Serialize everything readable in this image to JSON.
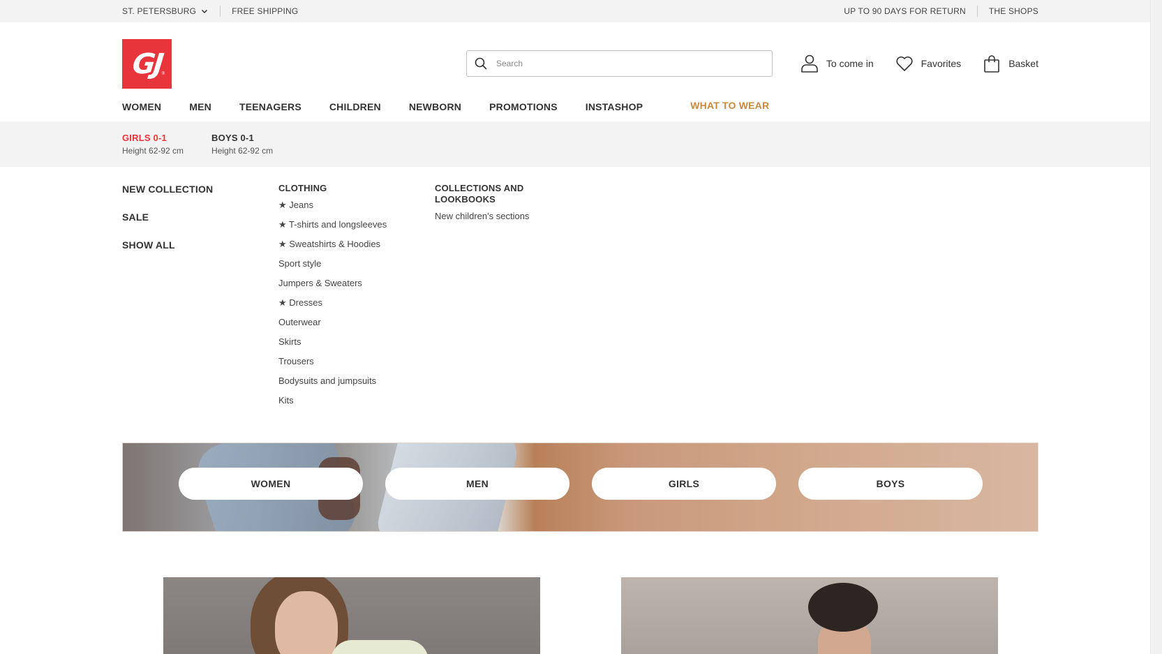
{
  "topbar": {
    "city": "ST. PETERSBURG",
    "shipping": "FREE SHIPPING",
    "returns": "UP TO 90 DAYS FOR RETURN",
    "shops": "THE SHOPS"
  },
  "header": {
    "logo": "GJ",
    "search_placeholder": "Search",
    "login": "To come in",
    "favorites": "Favorites",
    "basket": "Basket"
  },
  "nav": {
    "items": [
      "WOMEN",
      "MEN",
      "TEENAGERS",
      "CHILDREN",
      "NEWBORN",
      "PROMOTIONS",
      "INSTASHOP"
    ],
    "accent": "WHAT TO WEAR",
    "accent_color": "#c8893d"
  },
  "subnav": [
    {
      "title": "GIRLS 0-1",
      "subtitle": "Height 62-92 cm",
      "active": true
    },
    {
      "title": "BOYS 0-1",
      "subtitle": "Height 62-92 cm",
      "active": false
    }
  ],
  "menu": {
    "col1": [
      "NEW COLLECTION",
      "SALE",
      "SHOW ALL"
    ],
    "clothing_title": "CLOTHING",
    "clothing": [
      "★ Jeans",
      "★ T-shirts and longsleeves",
      "★ Sweatshirts & Hoodies",
      "Sport style",
      "Jumpers & Sweaters",
      "★ Dresses",
      "Outerwear",
      "Skirts",
      "Trousers",
      "Bodysuits and jumpsuits",
      "Kits"
    ],
    "collections_title": "COLLECTIONS AND LOOKBOOKS",
    "collections": [
      "New children's sections"
    ]
  },
  "banner": {
    "buttons": [
      "WOMEN",
      "MEN",
      "GIRLS",
      "BOYS"
    ]
  },
  "colors": {
    "brand": "#e8343b",
    "accent": "#c8893d",
    "topbar_bg": "#f3f3f3"
  }
}
